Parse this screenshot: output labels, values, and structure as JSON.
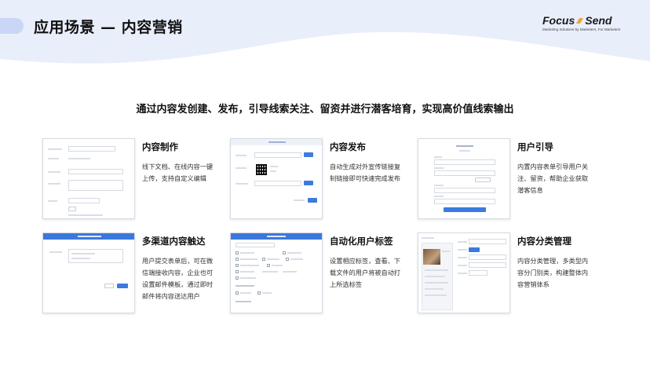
{
  "header": {
    "title": "应用场景 — 内容营销",
    "logo_left": "Focus",
    "logo_right": "Send",
    "logo_tagline": "Marketing Solutions by Marketers, For Marketers"
  },
  "subtitle": "通过内容发创建、发布，引导线索关注、留资并进行潜客培育，实现高价值线索输出",
  "colors": {
    "accent": "#3a78dc",
    "logo_orange": "#f2a33a",
    "wave": "#e9eefb"
  },
  "cards": [
    {
      "title": "内容制作",
      "desc": "线下文档、在线内容一键上传，支持自定义编辑"
    },
    {
      "title": "内容发布",
      "desc": "自动生成对外宣传链接复制链接即可快速完成发布"
    },
    {
      "title": "用户引导",
      "desc": "内置内容表单引导用户关注、留资，帮助企业获取潜客信息"
    },
    {
      "title": "多渠道内容触达",
      "desc": "用户提交表单后，可在微信端接收内容，企业也可设置邮件模板，通过即时邮件将内容送达用户"
    },
    {
      "title": "自动化用户标签",
      "desc": "设置相应标签，查看、下载文件的用户将被自动打上所选标签"
    },
    {
      "title": "内容分类管理",
      "desc": "内容分类管理，多类型内容分门别类，构建整体内容营销体系"
    }
  ]
}
